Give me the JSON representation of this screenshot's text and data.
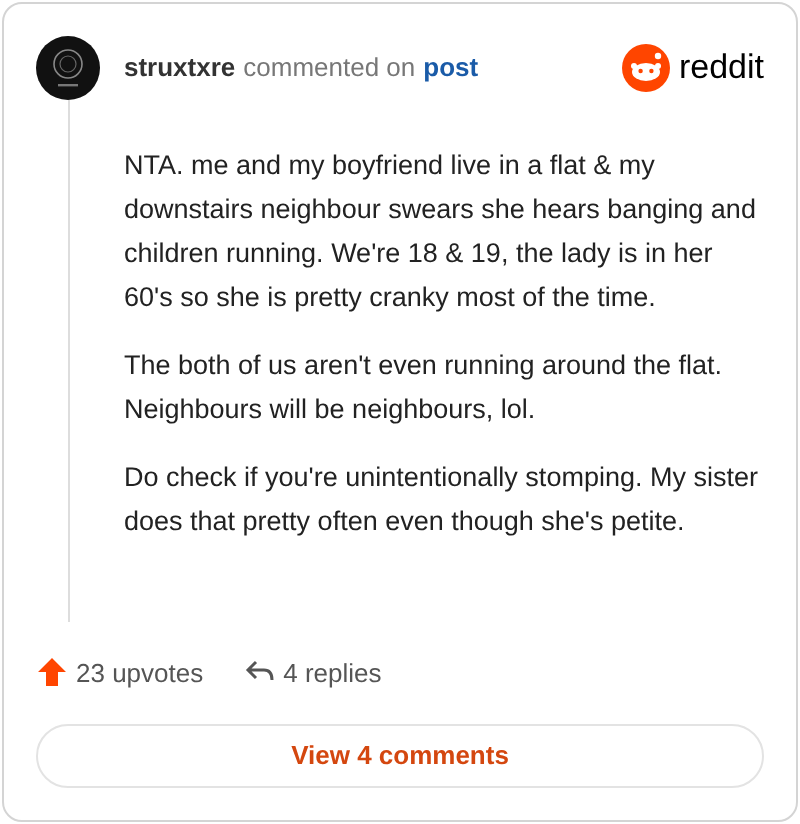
{
  "header": {
    "author": "struxtxre",
    "action": "commented on",
    "link": "post",
    "brand": "reddit"
  },
  "paragraphs": [
    "NTA. me and my boyfriend live in a flat & my downstairs neighbour swears she hears banging and children running. We're 18 & 19, the lady is in her 60's so she is pretty cranky most of the time.",
    "The both of us aren't even running around the flat. Neighbours will be neighbours, lol.",
    "Do check if you're unintentionally stomping. My sister does that pretty often even though she's petite."
  ],
  "footer": {
    "upvotes": "23 upvotes",
    "replies": "4 replies"
  },
  "button": "View 4 comments"
}
